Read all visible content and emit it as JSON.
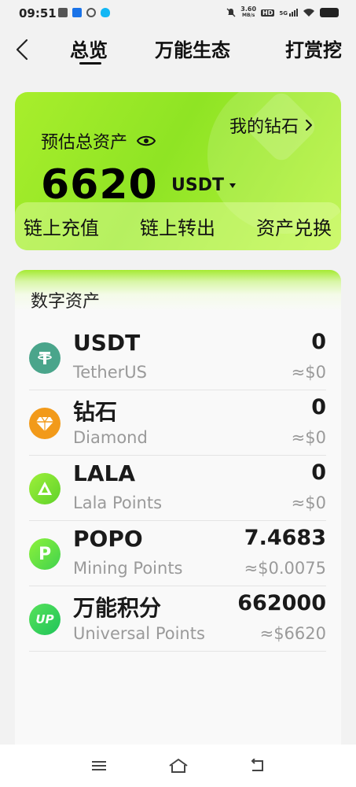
{
  "status_bar": {
    "time": "09:51",
    "net_speed_value": "3.60",
    "net_speed_unit": "MB/s",
    "hd": "HD",
    "network": "5G"
  },
  "header": {
    "tabs": [
      {
        "label": "总览",
        "active": true
      },
      {
        "label": "万能生态",
        "active": false
      },
      {
        "label": "打赏挖",
        "active": false
      }
    ]
  },
  "asset_card": {
    "label": "预估总资产",
    "my_diamond": "我的钻石",
    "total_value": "6620",
    "currency": "USDT",
    "actions": [
      "链上充值",
      "链上转出",
      "资产兑换"
    ]
  },
  "assets": {
    "title": "数字资产",
    "items": [
      {
        "name": "USDT",
        "subtitle": "TetherUS",
        "amount": "0",
        "fiat": "≈$0",
        "icon": "tether-icon",
        "color": "#4aa58b"
      },
      {
        "name": "钻石",
        "subtitle": "Diamond",
        "amount": "0",
        "fiat": "≈$0",
        "icon": "diamond-coin-icon",
        "color": "#f29a1a"
      },
      {
        "name": "LALA",
        "subtitle": "Lala Points",
        "amount": "0",
        "fiat": "≈$0",
        "icon": "lala-icon",
        "color": "#8ee228"
      },
      {
        "name": "POPO",
        "subtitle": "Mining Points",
        "amount": "7.4683",
        "fiat": "≈$0.0075",
        "icon": "popo-icon",
        "color": "#52d846"
      },
      {
        "name": "万能积分",
        "subtitle": "Universal Points",
        "amount": "662000",
        "fiat": "≈$6620",
        "icon": "up-icon",
        "color": "#2fcf5a"
      }
    ]
  },
  "colors": {
    "accent_green": "#9be82a",
    "background": "#f2f2f2"
  }
}
